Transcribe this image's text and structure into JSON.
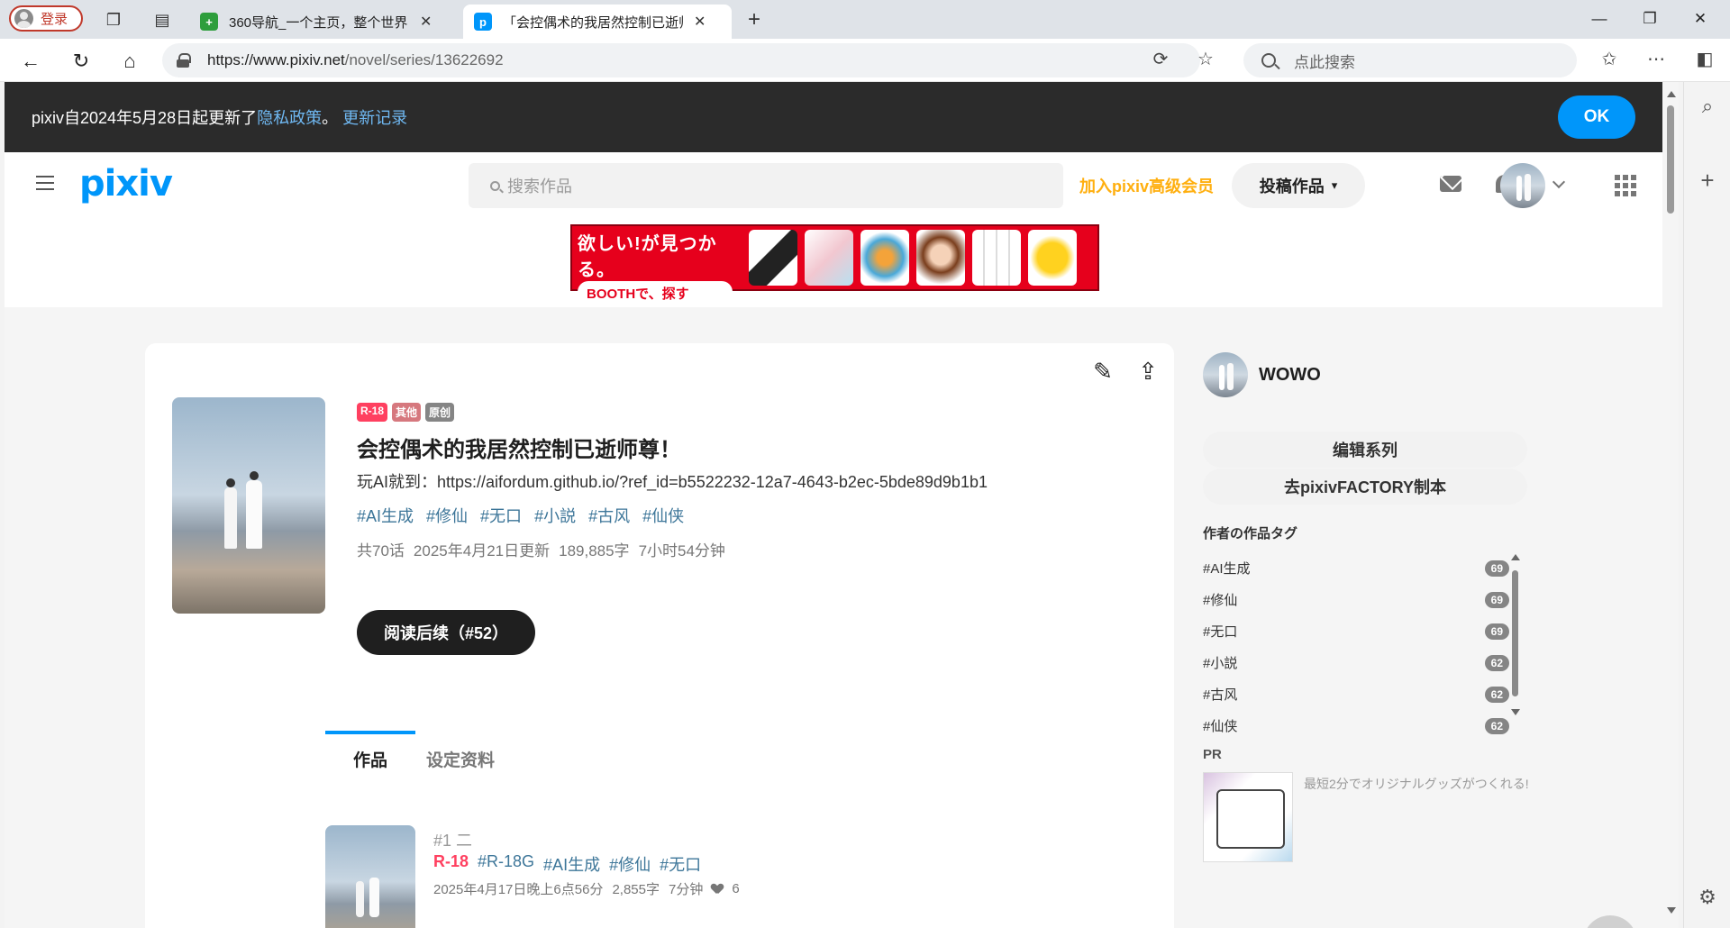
{
  "browser": {
    "login_label": "登录",
    "tabs": [
      {
        "title": "360导航_一个主页，整个世界",
        "favicon_color": "#2e9e3c"
      },
      {
        "title": "「会控偶术的我居然控制已逝师尊",
        "favicon_color": "#0096fa",
        "favicon_letter": "p"
      }
    ],
    "url_host": "https://www.pixiv.net",
    "url_path": "/novel/series/13622692",
    "search_placeholder": "点此搜索"
  },
  "notice": {
    "text": "pixiv自2024年5月28日起更新了",
    "privacy_link": "隐私政策",
    "punct": "。",
    "changelog_link": "更新记录",
    "ok_label": "OK"
  },
  "header": {
    "logo": "pixiv",
    "search_placeholder": "搜索作品",
    "premium_label": "加入pixiv高级会员",
    "post_label": "投稿作品"
  },
  "banner": {
    "slogan": "欲しい!が見つかる。",
    "booth_label": "BOOTHで、探す"
  },
  "series": {
    "badges": [
      "R-18",
      "其他",
      "原创"
    ],
    "title": "会控偶术的我居然控制已逝师尊！",
    "description": "玩AI就到：https://aifordum.github.io/?ref_id=b5522232-12a7-4643-b2ec-5bde89d9b1b1",
    "tags": [
      "#AI生成",
      "#修仙",
      "#无口",
      "#小説",
      "#古风",
      "#仙侠"
    ],
    "meta": [
      "共70话",
      "2025年4月21日更新",
      "189,885字",
      "7小时54分钟"
    ],
    "read_button": "阅读后续（#52）"
  },
  "content_tabs": [
    "作品",
    "设定资料"
  ],
  "episode": {
    "number": "#1 二",
    "rating": "R-18",
    "tags": [
      "#R-18G",
      "#AI生成",
      "#修仙",
      "#无口"
    ],
    "date": "2025年4月17日晚上6点56分",
    "chars": "2,855字",
    "time": "7分钟",
    "likes": "6"
  },
  "author": {
    "name": "WOWO",
    "edit_button": "编辑系列",
    "factory_button": "去pixivFACTORY制本",
    "tags_heading": "作者の作品タグ",
    "tags": [
      {
        "name": "#AI生成",
        "count": "69"
      },
      {
        "name": "#修仙",
        "count": "69"
      },
      {
        "name": "#无口",
        "count": "69"
      },
      {
        "name": "#小説",
        "count": "62"
      },
      {
        "name": "#古风",
        "count": "62"
      },
      {
        "name": "#仙侠",
        "count": "62"
      }
    ]
  },
  "pr": {
    "heading": "PR",
    "text": "最短2分でオリジナルグッズがつくれる!"
  },
  "colors": {
    "accent": "#0096fa",
    "premium": "#ffaf0f",
    "r18": "#ff4060",
    "tag": "#3d7699",
    "dark": "#1f1f1f"
  }
}
